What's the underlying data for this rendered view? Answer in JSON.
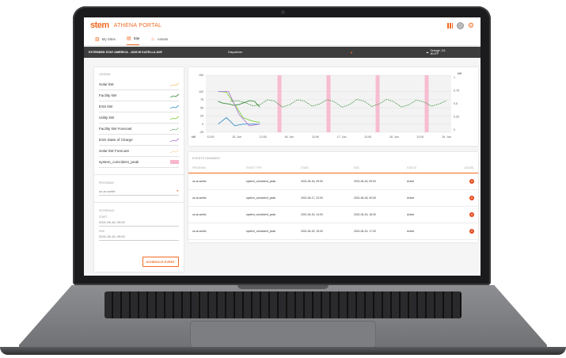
{
  "app": {
    "logo": "stem",
    "portal": "ATHENA PORTAL"
  },
  "tabs": [
    {
      "label": "My Sites"
    },
    {
      "label": "Site"
    },
    {
      "label": "Assets"
    }
  ],
  "sitebar": {
    "site_name": "EXTENDED STAY AMERICA - 1635 W KATELLA AVE",
    "dispatcher": "Dispatcher",
    "location": "Orange, CA",
    "temperature": "80.6°F"
  },
  "legend": {
    "title": "LEGEND",
    "items": [
      {
        "label": "Solar kW",
        "color": "#f0c674"
      },
      {
        "label": "Facility kW",
        "color": "#3a8f3a"
      },
      {
        "label": "ESS kW",
        "color": "#3a8fc8"
      },
      {
        "label": "Utility kW",
        "color": "#7bd33a"
      },
      {
        "label": "Facility kW Forecast",
        "color": "#3a8f3a"
      },
      {
        "label": "ESS State of Charge",
        "color": "#b07ad6"
      },
      {
        "label": "Solar kW Forecast",
        "color": "#f0c674"
      },
      {
        "label": "system_coincident_peak",
        "color": "#f7b6cd"
      }
    ]
  },
  "program": {
    "title": "PROGRAM",
    "value": "us-ar-sceltz"
  },
  "schedule": {
    "title": "SCHEDULE",
    "start_label": "START",
    "start_value": "2021-06-16, 09:00",
    "end_label": "END",
    "end_value": "2021-06-16, 09:00",
    "button": "SCHEDULE EVENT"
  },
  "chart_data": {
    "type": "line",
    "left_unit": "kW",
    "right_unit": "kW",
    "y_ticks_left": [
      150,
      100,
      75,
      50,
      25,
      0,
      -25
    ],
    "y_ticks_right": [
      "1",
      "0.75",
      "0.5",
      "0.25",
      "0"
    ],
    "x_ticks": [
      "12:00",
      "15. Jun",
      "12:00",
      "16. Jun",
      "12:00",
      "17. Jun",
      "12:00",
      "18. Jun",
      "12:00",
      "19. Jun"
    ],
    "series": [
      {
        "name": "Facility kW",
        "color": "#3a8f3a",
        "values": [
          70,
          64,
          62,
          58,
          60,
          66,
          72,
          70,
          52
        ]
      },
      {
        "name": "Utility kW",
        "color": "#7bd33a",
        "values": [
          100,
          98,
          60,
          20,
          10,
          5
        ]
      },
      {
        "name": "ESS kW",
        "color": "#3a8fc8",
        "values": [
          0,
          20,
          -5,
          0,
          0,
          0
        ]
      },
      {
        "name": "ESS State of Charge",
        "color": "#b07ad6",
        "values": [
          100,
          100,
          30,
          -5,
          0
        ]
      },
      {
        "name": "Facility kW Forecast",
        "color": "#3a8f3a",
        "values": [
          70,
          72,
          66,
          56,
          60,
          75,
          70,
          52,
          60,
          75,
          70,
          55,
          62,
          75,
          68,
          52,
          60,
          76,
          70,
          54,
          62,
          76,
          68,
          52,
          60,
          74,
          68,
          55,
          62,
          72
        ]
      }
    ],
    "events": [
      {
        "x": "2021-06-15, 16:00",
        "label": "system_coincident_peak"
      },
      {
        "x": "2021-06-16, 16:00",
        "label": "system_coincident_peak"
      },
      {
        "x": "2021-06-17, 16:00",
        "label": "system_coincident_peak"
      },
      {
        "x": "2021-06-18, 16:00",
        "label": "system_coincident_peak"
      }
    ]
  },
  "events_summary": {
    "title": "EVENTS SUMMARY",
    "columns": [
      "PROGRAM",
      "EVENT TYPE",
      "START",
      "END",
      "STATUS",
      "CANCEL"
    ],
    "rows": [
      {
        "program": "us-ar-sceltz",
        "type": "system_coincident_peak",
        "start": "2021-06-16, 09:00",
        "end": "2021-06-16, 09:00",
        "status": "Active"
      },
      {
        "program": "us-ar-sceltz",
        "type": "system_coincident_peak",
        "start": "2021-06-17, 22:00",
        "end": "2021-06-18, 00:00",
        "status": "Active"
      },
      {
        "program": "us-ar-sceltz",
        "type": "system_coincident_peak",
        "start": "2021-06-15, 14:00",
        "end": "2021-06-15, 16:00",
        "status": "Active"
      },
      {
        "program": "us-ar-sceltz",
        "type": "system_coincident_peak",
        "start": "2021-06-15, 15:00",
        "end": "2021-06-15, 17:00",
        "status": "Active"
      }
    ]
  }
}
